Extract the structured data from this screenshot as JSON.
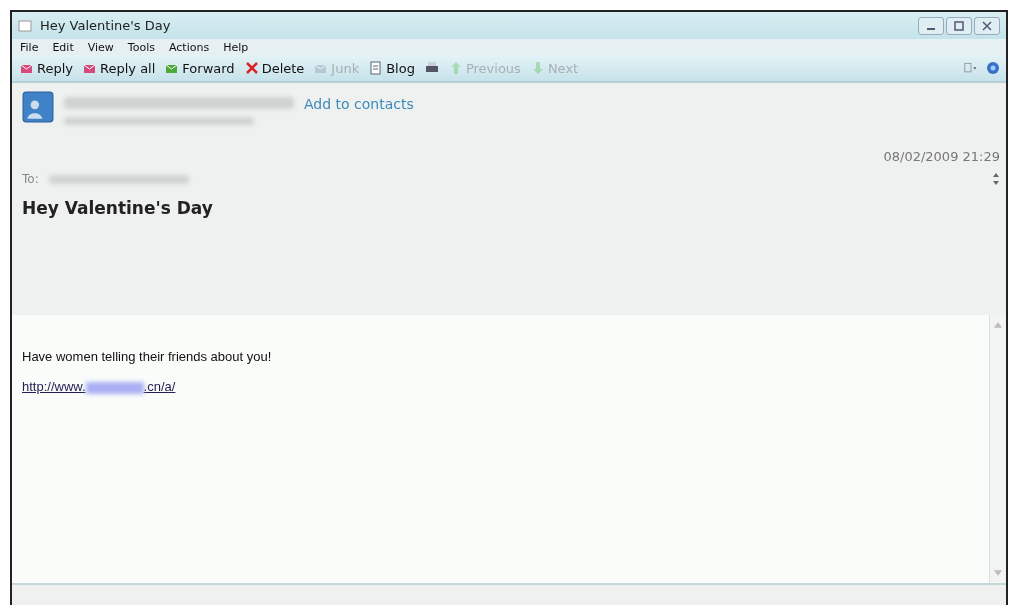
{
  "window": {
    "title": "Hey Valentine's Day"
  },
  "menu": [
    "File",
    "Edit",
    "View",
    "Tools",
    "Actions",
    "Help"
  ],
  "toolbar": [
    {
      "kind": "reply",
      "label": "Reply",
      "disabled": false
    },
    {
      "kind": "replyall",
      "label": "Reply all",
      "disabled": false
    },
    {
      "kind": "forward",
      "label": "Forward",
      "disabled": false
    },
    {
      "kind": "delete",
      "label": "Delete",
      "disabled": false
    },
    {
      "kind": "junk",
      "label": "Junk",
      "disabled": true
    },
    {
      "kind": "blog",
      "label": "Blog",
      "disabled": false
    },
    {
      "kind": "print",
      "disabled": false
    },
    {
      "kind": "previous",
      "label": "Previous",
      "disabled": true
    },
    {
      "kind": "next",
      "label": "Next",
      "disabled": true
    }
  ],
  "header": {
    "add_contact": "Add to contacts",
    "date": "08/02/2009 21:29",
    "to_label": "To:",
    "subject": "Hey Valentine's Day"
  },
  "body": {
    "text": "Have women telling their friends about you!",
    "link": {
      "before": "http://www.",
      "after": ".cn/a/"
    }
  }
}
